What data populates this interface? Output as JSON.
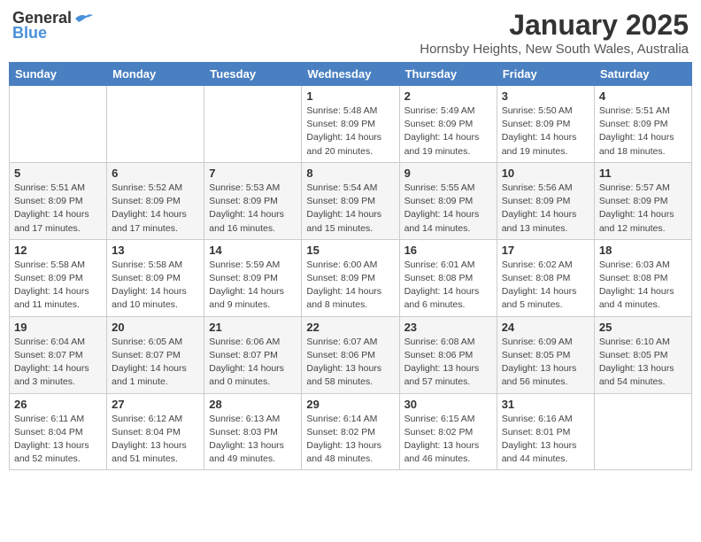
{
  "logo": {
    "line1": "General",
    "line2": "Blue"
  },
  "title": "January 2025",
  "location": "Hornsby Heights, New South Wales, Australia",
  "weekdays": [
    "Sunday",
    "Monday",
    "Tuesday",
    "Wednesday",
    "Thursday",
    "Friday",
    "Saturday"
  ],
  "weeks": [
    [
      {
        "day": "",
        "detail": ""
      },
      {
        "day": "",
        "detail": ""
      },
      {
        "day": "",
        "detail": ""
      },
      {
        "day": "1",
        "detail": "Sunrise: 5:48 AM\nSunset: 8:09 PM\nDaylight: 14 hours\nand 20 minutes."
      },
      {
        "day": "2",
        "detail": "Sunrise: 5:49 AM\nSunset: 8:09 PM\nDaylight: 14 hours\nand 19 minutes."
      },
      {
        "day": "3",
        "detail": "Sunrise: 5:50 AM\nSunset: 8:09 PM\nDaylight: 14 hours\nand 19 minutes."
      },
      {
        "day": "4",
        "detail": "Sunrise: 5:51 AM\nSunset: 8:09 PM\nDaylight: 14 hours\nand 18 minutes."
      }
    ],
    [
      {
        "day": "5",
        "detail": "Sunrise: 5:51 AM\nSunset: 8:09 PM\nDaylight: 14 hours\nand 17 minutes."
      },
      {
        "day": "6",
        "detail": "Sunrise: 5:52 AM\nSunset: 8:09 PM\nDaylight: 14 hours\nand 17 minutes."
      },
      {
        "day": "7",
        "detail": "Sunrise: 5:53 AM\nSunset: 8:09 PM\nDaylight: 14 hours\nand 16 minutes."
      },
      {
        "day": "8",
        "detail": "Sunrise: 5:54 AM\nSunset: 8:09 PM\nDaylight: 14 hours\nand 15 minutes."
      },
      {
        "day": "9",
        "detail": "Sunrise: 5:55 AM\nSunset: 8:09 PM\nDaylight: 14 hours\nand 14 minutes."
      },
      {
        "day": "10",
        "detail": "Sunrise: 5:56 AM\nSunset: 8:09 PM\nDaylight: 14 hours\nand 13 minutes."
      },
      {
        "day": "11",
        "detail": "Sunrise: 5:57 AM\nSunset: 8:09 PM\nDaylight: 14 hours\nand 12 minutes."
      }
    ],
    [
      {
        "day": "12",
        "detail": "Sunrise: 5:58 AM\nSunset: 8:09 PM\nDaylight: 14 hours\nand 11 minutes."
      },
      {
        "day": "13",
        "detail": "Sunrise: 5:58 AM\nSunset: 8:09 PM\nDaylight: 14 hours\nand 10 minutes."
      },
      {
        "day": "14",
        "detail": "Sunrise: 5:59 AM\nSunset: 8:09 PM\nDaylight: 14 hours\nand 9 minutes."
      },
      {
        "day": "15",
        "detail": "Sunrise: 6:00 AM\nSunset: 8:09 PM\nDaylight: 14 hours\nand 8 minutes."
      },
      {
        "day": "16",
        "detail": "Sunrise: 6:01 AM\nSunset: 8:08 PM\nDaylight: 14 hours\nand 6 minutes."
      },
      {
        "day": "17",
        "detail": "Sunrise: 6:02 AM\nSunset: 8:08 PM\nDaylight: 14 hours\nand 5 minutes."
      },
      {
        "day": "18",
        "detail": "Sunrise: 6:03 AM\nSunset: 8:08 PM\nDaylight: 14 hours\nand 4 minutes."
      }
    ],
    [
      {
        "day": "19",
        "detail": "Sunrise: 6:04 AM\nSunset: 8:07 PM\nDaylight: 14 hours\nand 3 minutes."
      },
      {
        "day": "20",
        "detail": "Sunrise: 6:05 AM\nSunset: 8:07 PM\nDaylight: 14 hours\nand 1 minute."
      },
      {
        "day": "21",
        "detail": "Sunrise: 6:06 AM\nSunset: 8:07 PM\nDaylight: 14 hours\nand 0 minutes."
      },
      {
        "day": "22",
        "detail": "Sunrise: 6:07 AM\nSunset: 8:06 PM\nDaylight: 13 hours\nand 58 minutes."
      },
      {
        "day": "23",
        "detail": "Sunrise: 6:08 AM\nSunset: 8:06 PM\nDaylight: 13 hours\nand 57 minutes."
      },
      {
        "day": "24",
        "detail": "Sunrise: 6:09 AM\nSunset: 8:05 PM\nDaylight: 13 hours\nand 56 minutes."
      },
      {
        "day": "25",
        "detail": "Sunrise: 6:10 AM\nSunset: 8:05 PM\nDaylight: 13 hours\nand 54 minutes."
      }
    ],
    [
      {
        "day": "26",
        "detail": "Sunrise: 6:11 AM\nSunset: 8:04 PM\nDaylight: 13 hours\nand 52 minutes."
      },
      {
        "day": "27",
        "detail": "Sunrise: 6:12 AM\nSunset: 8:04 PM\nDaylight: 13 hours\nand 51 minutes."
      },
      {
        "day": "28",
        "detail": "Sunrise: 6:13 AM\nSunset: 8:03 PM\nDaylight: 13 hours\nand 49 minutes."
      },
      {
        "day": "29",
        "detail": "Sunrise: 6:14 AM\nSunset: 8:02 PM\nDaylight: 13 hours\nand 48 minutes."
      },
      {
        "day": "30",
        "detail": "Sunrise: 6:15 AM\nSunset: 8:02 PM\nDaylight: 13 hours\nand 46 minutes."
      },
      {
        "day": "31",
        "detail": "Sunrise: 6:16 AM\nSunset: 8:01 PM\nDaylight: 13 hours\nand 44 minutes."
      },
      {
        "day": "",
        "detail": ""
      }
    ]
  ]
}
